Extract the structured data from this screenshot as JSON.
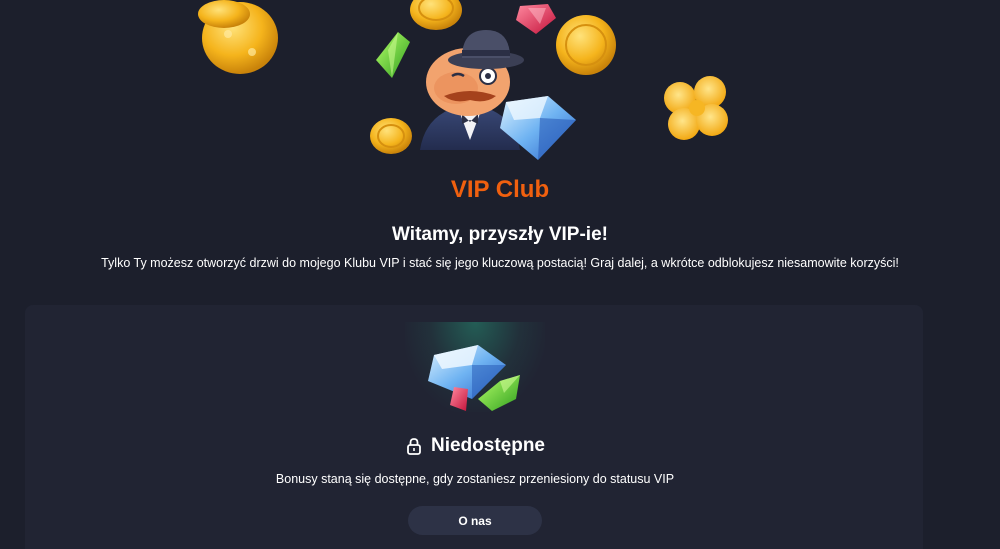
{
  "hero": {
    "image": "vip-mascot-illustration",
    "decorations": [
      "coin-icon",
      "gem-icon",
      "clover-icon",
      "diamond-icon"
    ]
  },
  "header": {
    "title": "VIP Club",
    "welcome": "Witamy, przyszły VIP-ie!",
    "description": "Tylko Ty możesz otworzyć drzwi do mojego Klubu VIP i stać się jego kluczową postacią! Graj dalej, a wkrótce odblokujesz niesamowite korzyści!"
  },
  "status_card": {
    "image": "gems-illustration",
    "status_icon": "lock-icon",
    "status_label": "Niedostępne",
    "info": "Bonusy staną się dostępne, gdy zostaniesz przeniesiony do statusu VIP",
    "button_label": "O nas"
  },
  "colors": {
    "background": "#1c1f2c",
    "card": "#212433",
    "accent": "#f0600f",
    "button": "#2d3246"
  }
}
